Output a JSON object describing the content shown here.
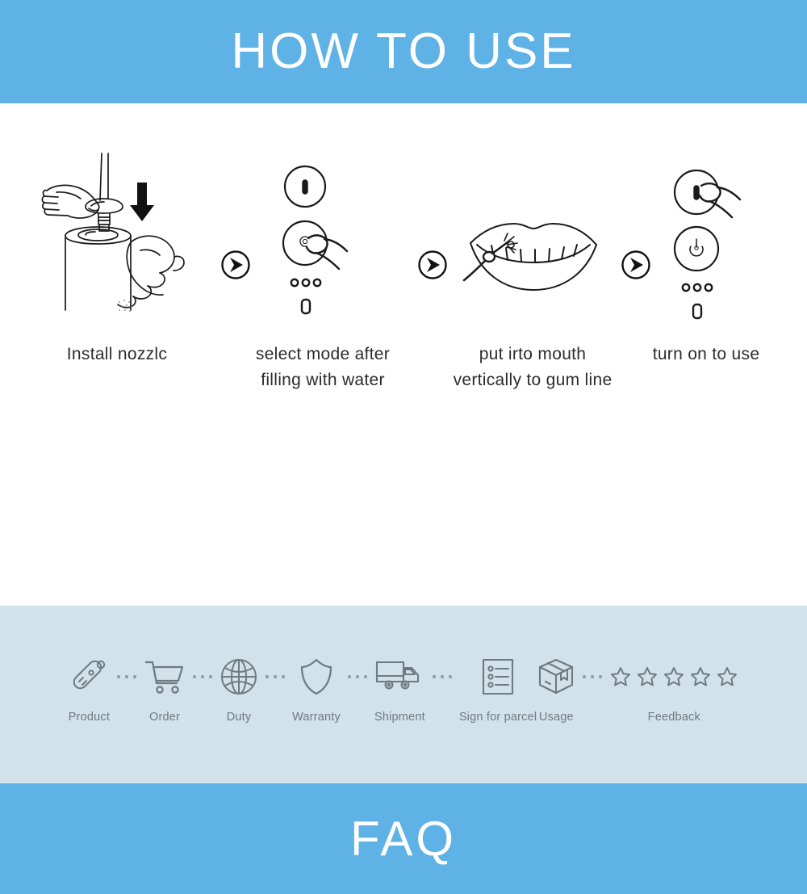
{
  "banners": {
    "top_title": "HOW TO USE",
    "bottom_title": "FAQ",
    "band_color": "#5fb2e6",
    "band_text_color": "#ffffff"
  },
  "how_to_use": {
    "steps": [
      {
        "index": 1,
        "caption": "Install nozzlc",
        "illustration": "hands-installing-nozzle-on-water-flosser-tank-with-down-arrow"
      },
      {
        "index": 2,
        "caption": "select mode after\nfilling with water",
        "illustration": "finger-pressing-mode-button-with-indicator-dots"
      },
      {
        "index": 3,
        "caption": "put irto mouth\nvertically to gum line",
        "illustration": "open-mouth-with-teeth-and-nozzle-at-gum-line"
      },
      {
        "index": 4,
        "caption": "turn on to use",
        "illustration": "finger-pressing-power-button-with-indicator-dots"
      }
    ],
    "separators": [
      {
        "icon": "circled-play-arrow-icon"
      },
      {
        "icon": "circled-play-arrow-icon"
      },
      {
        "icon": "circled-play-arrow-icon"
      }
    ],
    "caption_color": "#2b2b2b",
    "line_art_color": "#1a1a1a"
  },
  "process_strip": {
    "background_color": "#d2e2ea",
    "icon_color": "#6e7a80",
    "label_color": "#6e7a80",
    "items": [
      {
        "label": "Product",
        "icon": "electric-toothbrush-icon",
        "separator_after": true
      },
      {
        "label": "Order",
        "icon": "shopping-cart-icon",
        "separator_after": true
      },
      {
        "label": "Duty",
        "icon": "globe-icon",
        "separator_after": true
      },
      {
        "label": "Warranty",
        "icon": "shield-icon",
        "separator_after": true
      },
      {
        "label": "Shipment",
        "icon": "delivery-truck-icon",
        "separator_after": true
      },
      {
        "label": "Sign for parcel",
        "icon": "checklist-document-icon",
        "separator_after": false
      },
      {
        "label": "Usage",
        "icon": "package-box-icon",
        "separator_after": true
      },
      {
        "label": "Feedback",
        "icon": "five-stars-icon",
        "separator_after": false,
        "star_count": 5
      }
    ]
  }
}
